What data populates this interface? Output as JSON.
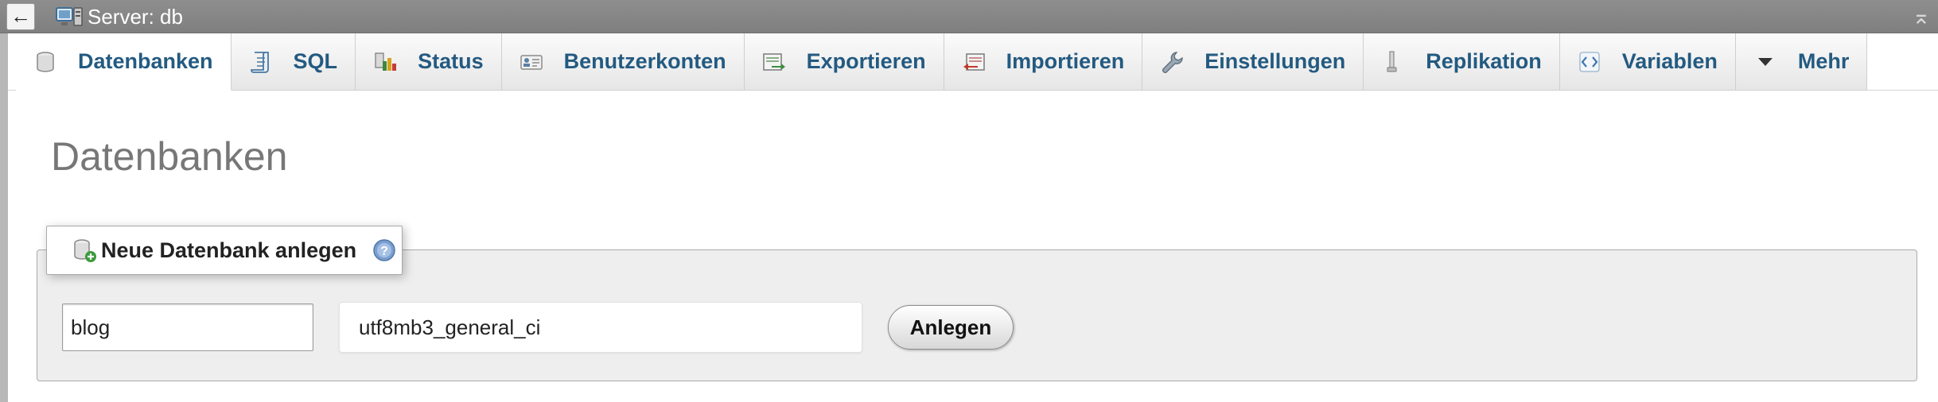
{
  "server_bar": {
    "title": "Server: db",
    "back_glyph": "←",
    "back_icon": "arrow-left-icon",
    "server_icon": "server-monitor-icon",
    "collapse_glyph": "⌅",
    "collapse_icon": "collapse-up-icon"
  },
  "tabs": [
    {
      "label": "Datenbanken",
      "icon": "database-icon",
      "active": true
    },
    {
      "label": "SQL",
      "icon": "sql-scroll-icon",
      "active": false
    },
    {
      "label": "Status",
      "icon": "status-chart-icon",
      "active": false
    },
    {
      "label": "Benutzerkonten",
      "icon": "user-accounts-icon",
      "active": false
    },
    {
      "label": "Exportieren",
      "icon": "export-icon",
      "active": false
    },
    {
      "label": "Importieren",
      "icon": "import-icon",
      "active": false
    },
    {
      "label": "Einstellungen",
      "icon": "wrench-icon",
      "active": false
    },
    {
      "label": "Replikation",
      "icon": "replication-icon",
      "active": false
    },
    {
      "label": "Variablen",
      "icon": "variables-icon",
      "active": false
    },
    {
      "label": "Mehr",
      "icon": "triangle-down-icon",
      "active": false
    }
  ],
  "page": {
    "title": "Datenbanken"
  },
  "create_db": {
    "legend": "Neue Datenbank anlegen",
    "legend_icon": "database-add-icon",
    "help_icon": "help-icon",
    "name_value": "blog",
    "collation_value": "utf8mb3_general_ci",
    "submit_label": "Anlegen"
  },
  "colors": {
    "tab_text": "#235a81",
    "topbar": "#8e8e8e",
    "fieldset_bg": "#eeeeee"
  }
}
